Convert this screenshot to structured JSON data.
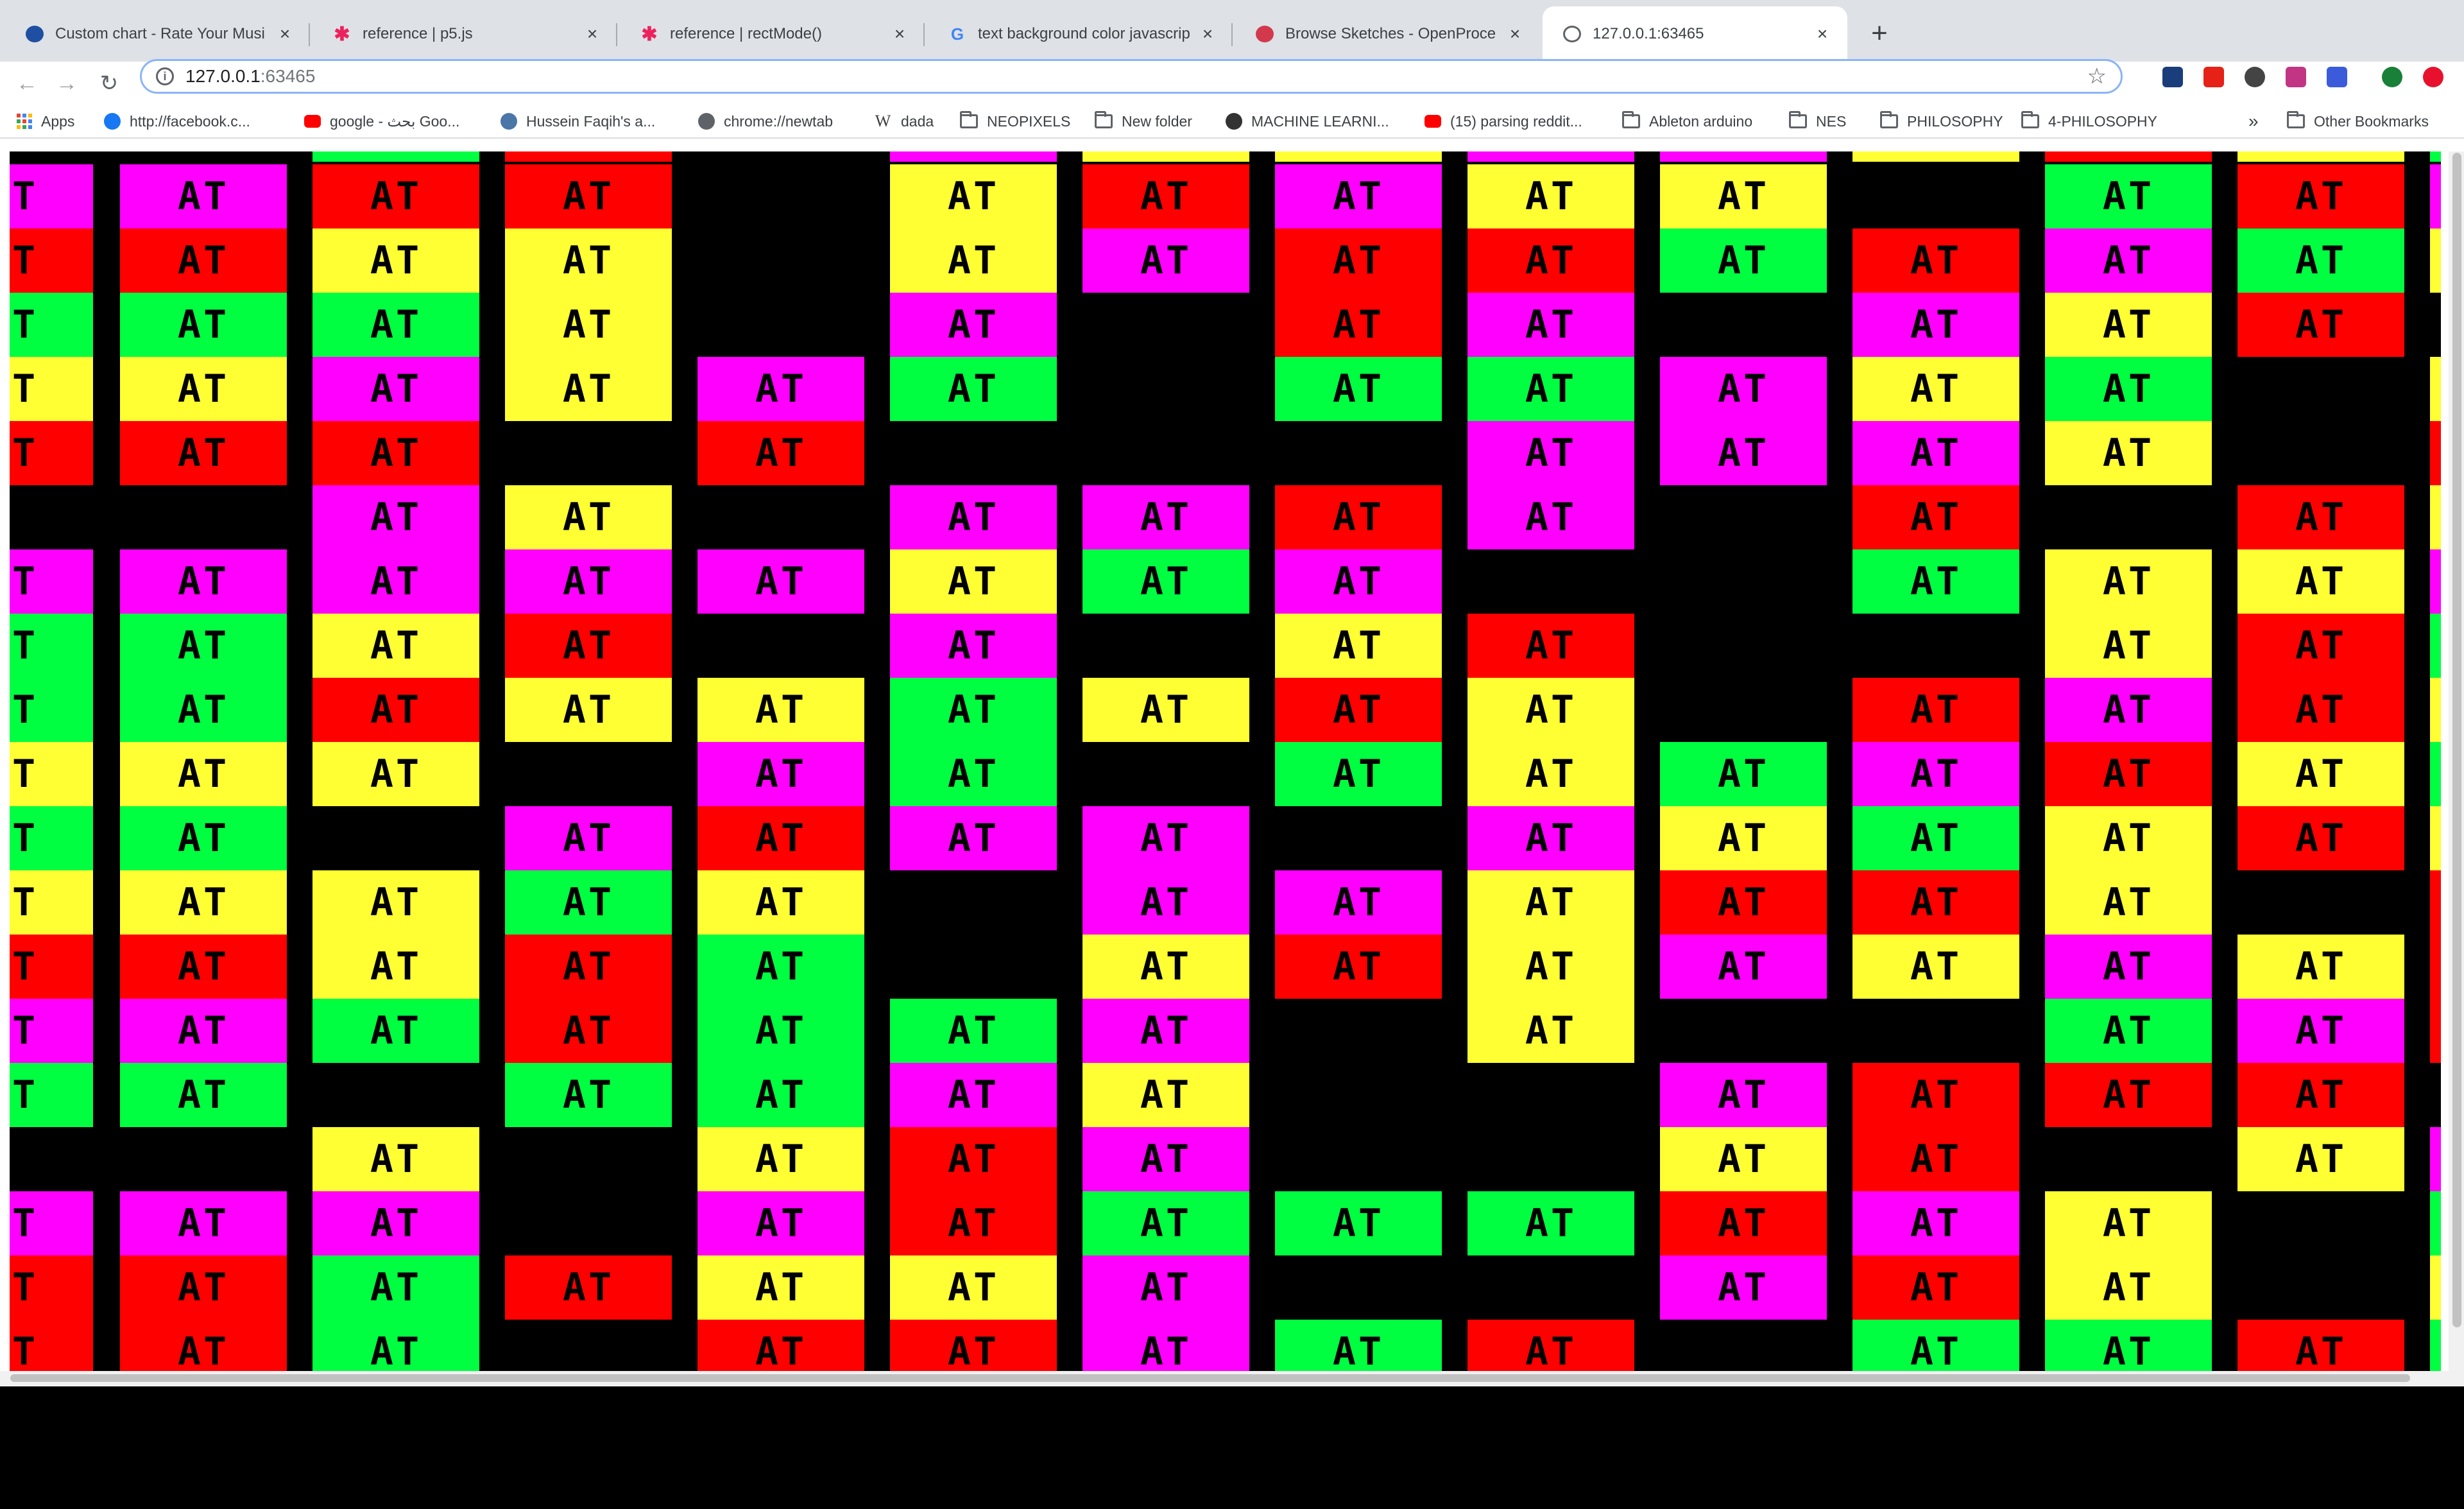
{
  "browser": {
    "tabs": [
      {
        "title": "Custom chart - Rate Your Musi",
        "icon": "rym-icon",
        "color": "#1f4fa3",
        "active": false
      },
      {
        "title": "reference | p5.js",
        "icon": "p5js-icon",
        "color": "#ed225d",
        "active": false
      },
      {
        "title": "reference | rectMode()",
        "icon": "p5js-icon",
        "color": "#ed225d",
        "active": false
      },
      {
        "title": "text background color javascrip",
        "icon": "google-icon",
        "color": "#4285f4",
        "active": false
      },
      {
        "title": "Browse Sketches - OpenProce",
        "icon": "openprocessing-icon",
        "color": "#d3394c",
        "active": false
      },
      {
        "title": "127.0.0.1:63465",
        "icon": "globe-icon",
        "color": "#5f6368",
        "active": true
      }
    ],
    "url": {
      "host": "127.0.0.1",
      "port": ":63465"
    },
    "bookmarks": [
      {
        "label": "Apps",
        "icon": "apps-grid-icon"
      },
      {
        "label": "http://facebook.c...",
        "icon": "facebook-icon"
      },
      {
        "label": "google - بحث Goo...",
        "icon": "youtube-icon"
      },
      {
        "label": "Hussein Faqih's a...",
        "icon": "vk-icon"
      },
      {
        "label": "chrome://newtab",
        "icon": "chrome-icon"
      },
      {
        "label": "dada",
        "icon": "wikipedia-icon"
      },
      {
        "label": "NEOPIXELS",
        "icon": "folder-icon"
      },
      {
        "label": "New folder",
        "icon": "folder-icon"
      },
      {
        "label": "MACHINE LEARNI...",
        "icon": "site-icon"
      },
      {
        "label": "(15) parsing reddit...",
        "icon": "youtube-icon"
      },
      {
        "label": "Ableton arduino",
        "icon": "folder-icon"
      },
      {
        "label": "NES",
        "icon": "folder-icon"
      },
      {
        "label": "PHILOSOPHY",
        "icon": "folder-icon"
      },
      {
        "label": "4-PHILOSOPHY",
        "icon": "folder-icon"
      }
    ],
    "bookmarks_overflow": "»",
    "other_bookmarks": "Other Bookmarks"
  },
  "sketch": {
    "tile_text": "AT",
    "partial_text": "T",
    "colors": {
      "R": "#ff0000",
      "Y": "#ffff33",
      "G": "#00ff41",
      "M": "#ff00ff",
      "B": "#000000"
    },
    "top_row": "BGRBMYYMMYRYG",
    "grid": [
      "MRRBYRMYYBGRM",
      "RYYBYMRRGRMGY",
      "GGYBMBRMBMYRB",
      "YMYMGBGGMYGBY",
      "RRBRBBBMMMYBR",
      "BMYBMMRMBRBRY",
      "MMMMYGMBBGYYM",
      "GYRBMBYRBBYRG",
      "GRYYGYRYBRMRY",
      "YYBMGBGYGMRYG",
      "GBMRMMBMYGYRY",
      "YYGYBMMYRRYBR",
      "RYRGBYRYMYMYR",
      "MGRGGMBYBBGMR",
      "GBGGMYBBMRRRB",
      "BYBYRMBBYRBYM",
      "MMBMRGGGRMYBG",
      "RGRYYMBBMRYBY",
      "RGBRRMGRBGGRG"
    ]
  }
}
